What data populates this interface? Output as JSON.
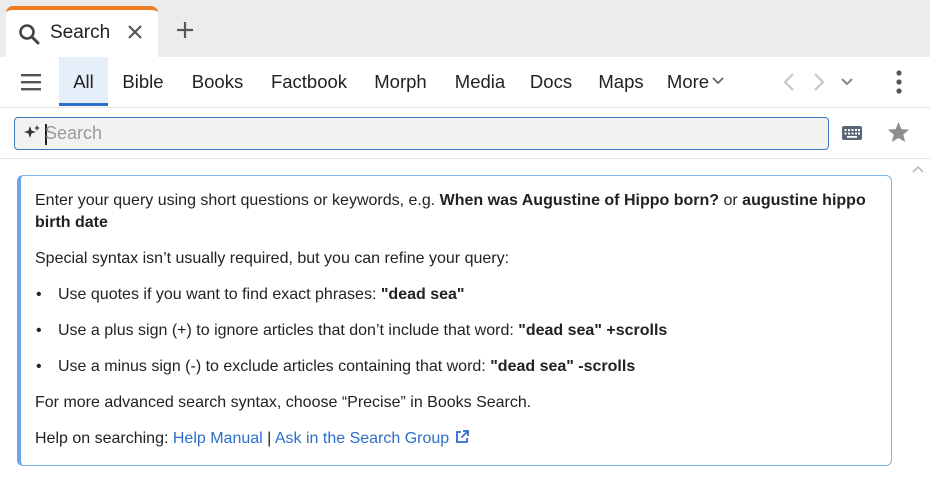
{
  "tab": {
    "title": "Search"
  },
  "toolbar": {
    "categories": [
      {
        "label": "All",
        "active": true
      },
      {
        "label": "Bible"
      },
      {
        "label": "Books"
      },
      {
        "label": "Factbook"
      },
      {
        "label": "Morph"
      },
      {
        "label": "Media"
      },
      {
        "label": "Docs"
      },
      {
        "label": "Maps"
      },
      {
        "label": "More"
      }
    ]
  },
  "search": {
    "placeholder": "Search",
    "value": ""
  },
  "help": {
    "intro": "Enter your query using short questions or keywords, e.g. ",
    "example1": "When was Augustine of Hippo born?",
    "or": " or ",
    "example2": "augustine hippo birth date",
    "special": "Special syntax isn’t usually required, but you can refine your query:",
    "bullets": [
      {
        "text": "Use quotes if you want to find exact phrases: ",
        "example": "\"dead sea\""
      },
      {
        "text": "Use a plus sign (+) to ignore articles that don’t include that word: ",
        "example": "\"dead sea\" +scrolls"
      },
      {
        "text": "Use a minus sign (-) to exclude articles containing that word: ",
        "example": "\"dead sea\" -scrolls"
      }
    ],
    "advanced": "For more advanced search syntax, choose “Precise” in Books Search.",
    "help_label": "Help on searching: ",
    "help_manual": "Help Manual",
    "separator": "|",
    "ask_group": "Ask in the Search Group"
  },
  "colors": {
    "accent": "#2d6ec9",
    "tab_highlight": "#f07d22",
    "panel_border": "#6ea7e8"
  },
  "icons": [
    "search-icon",
    "close-icon",
    "plus-icon",
    "hamburger-icon",
    "chevron-down-icon",
    "back-arrow-icon",
    "forward-arrow-icon",
    "kebab-icon",
    "sparkle-icon",
    "keyboard-icon",
    "star-icon",
    "chevron-up-icon",
    "external-link-icon"
  ]
}
